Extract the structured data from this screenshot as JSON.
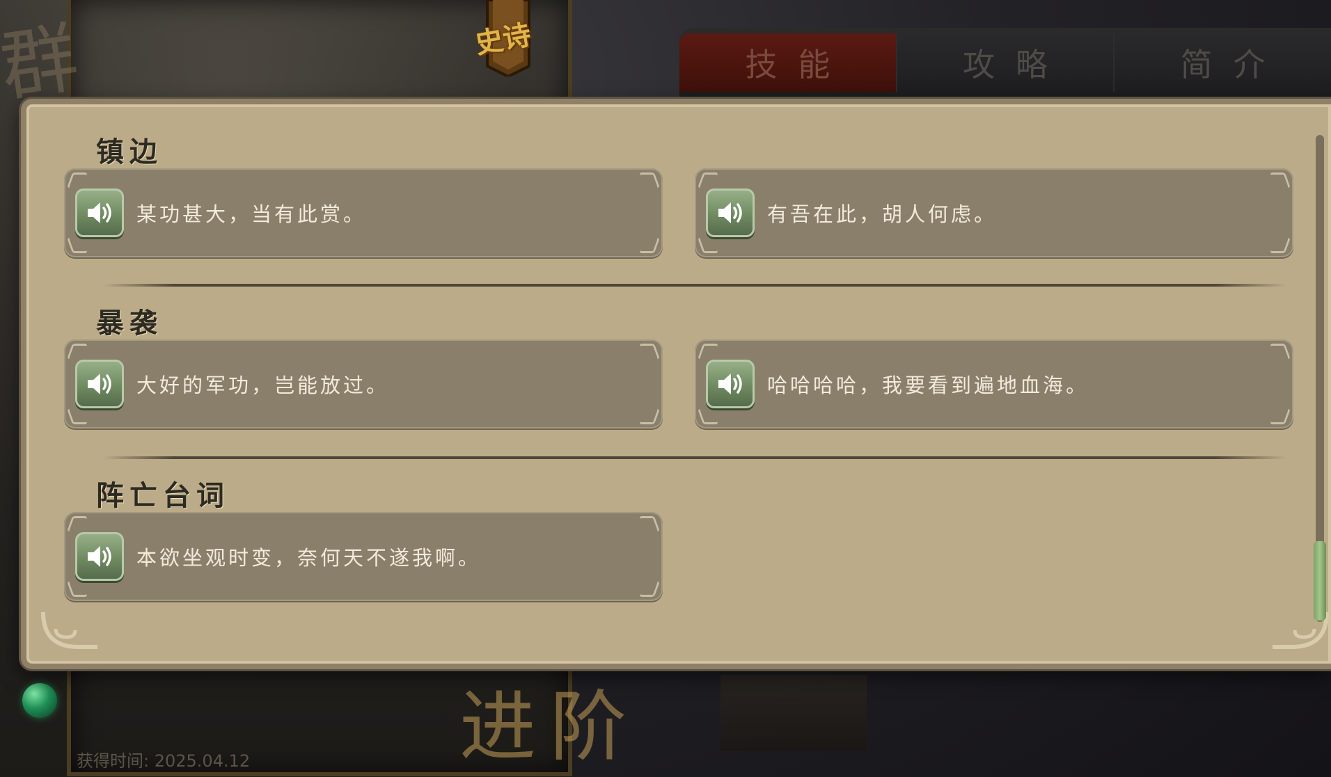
{
  "background": {
    "faction_glyph": "群",
    "rarity_label": "史诗",
    "advance_label": "进阶",
    "obtain_time": "获得时间: 2025.04.12"
  },
  "tabs": [
    {
      "label": "技能",
      "active": true
    },
    {
      "label": "攻略",
      "active": false
    },
    {
      "label": "简介",
      "active": false
    }
  ],
  "sections": [
    {
      "title": "镇边",
      "lines": [
        {
          "text": "某功甚大，当有此赏。",
          "icon": "speaker-icon"
        },
        {
          "text": "有吾在此，胡人何虑。",
          "icon": "speaker-icon"
        }
      ]
    },
    {
      "title": "暴袭",
      "lines": [
        {
          "text": "大好的军功，岂能放过。",
          "icon": "speaker-icon"
        },
        {
          "text": "哈哈哈哈，我要看到遍地血海。",
          "icon": "speaker-icon"
        }
      ]
    },
    {
      "title": "阵亡台词",
      "lines": [
        {
          "text": "本欲坐观时变，奈何天不遂我啊。",
          "icon": "speaker-icon"
        }
      ]
    }
  ],
  "colors": {
    "panel": "#bcab88",
    "line_card": "#8a7f6a",
    "speaker_button": "#6f8a61",
    "active_tab": "#5a1a12"
  }
}
